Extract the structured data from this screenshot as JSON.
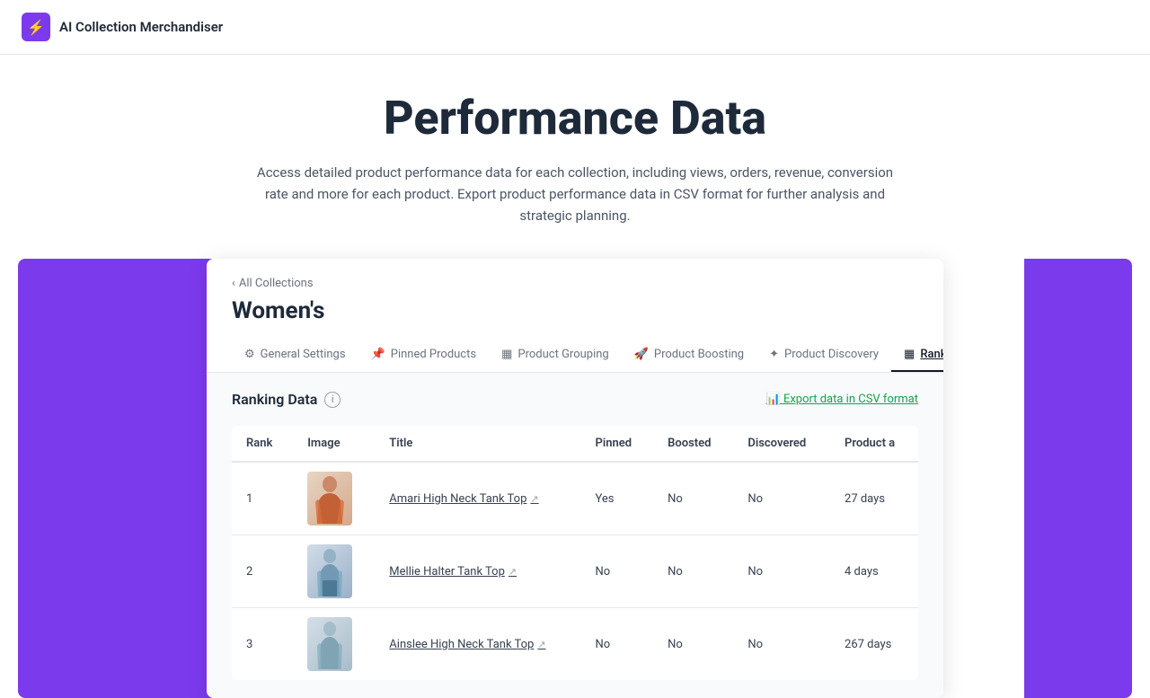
{
  "nav": {
    "logo_symbol": "⚡",
    "title": "AI Collection Merchandiser"
  },
  "hero": {
    "title": "Performance Data",
    "description": "Access detailed product performance data for each collection, including views, orders, revenue, conversion rate\nand more for each product. Export product performance data in CSV format for further analysis and strategic planning."
  },
  "app": {
    "back_label": "All Collections",
    "collection_name": "Women's",
    "tabs": [
      {
        "id": "general",
        "icon": "⚙",
        "label": "General Settings",
        "active": false
      },
      {
        "id": "pinned",
        "icon": "📌",
        "label": "Pinned Products",
        "active": false
      },
      {
        "id": "grouping",
        "icon": "▦",
        "label": "Product Grouping",
        "active": false
      },
      {
        "id": "boosting",
        "icon": "🚀",
        "label": "Product Boosting",
        "active": false
      },
      {
        "id": "discovery",
        "icon": "✦",
        "label": "Product Discovery",
        "active": false
      },
      {
        "id": "ranking",
        "icon": "▦",
        "label": "Ranking Data",
        "active": true
      }
    ],
    "section_title": "Ranking Data",
    "export_label": "📊 Export data in CSV format",
    "table": {
      "headers": [
        "Rank",
        "Image",
        "Title",
        "Pinned",
        "Boosted",
        "Discovered",
        "Product a"
      ],
      "rows": [
        {
          "rank": "1",
          "title": "Amari High Neck Tank Top",
          "title_link": true,
          "img_class": "img-1",
          "pinned": "Yes",
          "boosted": "No",
          "discovered": "No",
          "product_age": "27 days"
        },
        {
          "rank": "2",
          "title": "Mellie Halter Tank Top",
          "title_link": true,
          "img_class": "img-2",
          "pinned": "No",
          "boosted": "No",
          "discovered": "No",
          "product_age": "4 days"
        },
        {
          "rank": "3",
          "title": "Ainslee High Neck Tank Top",
          "title_link": true,
          "img_class": "img-3",
          "pinned": "No",
          "boosted": "No",
          "discovered": "No",
          "product_age": "267 days"
        }
      ]
    }
  }
}
